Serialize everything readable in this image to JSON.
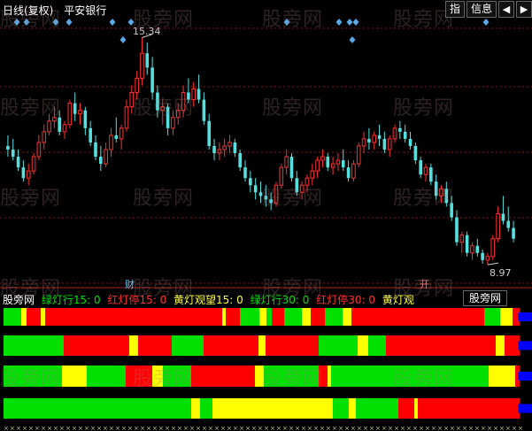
{
  "header": {
    "period": "日线(复权)",
    "stock_name": "平安银行"
  },
  "buttons": {
    "zhi": "指",
    "info": "信息",
    "left": "◀",
    "right": "▶"
  },
  "price": {
    "high": "15.34",
    "low": "8.97"
  },
  "markers": {
    "cai": "财",
    "kai": "开"
  },
  "watermark": "股旁网",
  "indicator": {
    "source": "股旁网",
    "green_line_15": "绿灯行15: 0",
    "red_line_15": "红灯停15: 0",
    "yellow_watch_15": "黄灯观望15: 0",
    "green_line_30": "绿灯行30: 0",
    "red_line_30": "红灯停30: 0",
    "yellow_watch": "黄灯观",
    "right_tab": "股旁网"
  },
  "colors": {
    "up": "#ff3030",
    "down": "#55e0e0",
    "green": "#00e000",
    "red": "#ff0000",
    "yellow": "#ffff00",
    "blue": "#0000ff",
    "diamond": "#5aa8e6",
    "grid": "#8b1010"
  },
  "chart_data": {
    "type": "candlestick",
    "ylim": [
      8.5,
      15.8
    ],
    "candles": [
      [
        12.3,
        12.6,
        12.0,
        12.2
      ],
      [
        12.2,
        12.5,
        11.9,
        12.0
      ],
      [
        12.0,
        12.2,
        11.6,
        11.7
      ],
      [
        11.7,
        11.9,
        11.3,
        11.4
      ],
      [
        11.4,
        11.8,
        11.2,
        11.6
      ],
      [
        11.6,
        12.1,
        11.5,
        12.0
      ],
      [
        12.0,
        12.6,
        11.9,
        12.4
      ],
      [
        12.4,
        12.9,
        12.2,
        12.7
      ],
      [
        12.7,
        13.2,
        12.6,
        13.0
      ],
      [
        13.0,
        13.4,
        12.8,
        13.1
      ],
      [
        13.1,
        13.3,
        12.6,
        12.7
      ],
      [
        12.7,
        13.0,
        12.5,
        12.9
      ],
      [
        12.9,
        13.6,
        12.8,
        13.5
      ],
      [
        13.5,
        13.8,
        13.0,
        13.2
      ],
      [
        13.2,
        13.5,
        12.9,
        13.3
      ],
      [
        13.3,
        13.4,
        12.6,
        12.8
      ],
      [
        12.8,
        13.0,
        12.3,
        12.4
      ],
      [
        12.4,
        12.6,
        11.9,
        12.0
      ],
      [
        12.0,
        12.3,
        11.6,
        11.8
      ],
      [
        11.8,
        12.4,
        11.7,
        12.2
      ],
      [
        12.2,
        12.8,
        12.0,
        12.6
      ],
      [
        12.6,
        13.1,
        12.4,
        12.5
      ],
      [
        12.5,
        12.9,
        12.2,
        12.8
      ],
      [
        12.8,
        13.6,
        12.7,
        13.4
      ],
      [
        13.4,
        14.0,
        13.2,
        13.8
      ],
      [
        13.8,
        14.4,
        13.6,
        14.2
      ],
      [
        14.2,
        15.34,
        14.0,
        14.9
      ],
      [
        14.9,
        15.2,
        14.3,
        14.5
      ],
      [
        14.5,
        14.8,
        13.6,
        13.8
      ],
      [
        13.8,
        14.0,
        13.1,
        13.3
      ],
      [
        13.3,
        13.6,
        12.9,
        13.4
      ],
      [
        13.4,
        13.5,
        12.6,
        12.8
      ],
      [
        12.8,
        13.3,
        12.6,
        13.1
      ],
      [
        13.1,
        13.5,
        12.9,
        13.3
      ],
      [
        13.3,
        14.0,
        13.1,
        13.8
      ],
      [
        13.8,
        14.2,
        13.5,
        13.6
      ],
      [
        13.6,
        14.1,
        13.4,
        13.9
      ],
      [
        13.9,
        14.3,
        13.5,
        13.6
      ],
      [
        13.6,
        13.8,
        12.9,
        13.0
      ],
      [
        13.0,
        13.2,
        12.2,
        12.3
      ],
      [
        12.3,
        12.5,
        11.9,
        12.1
      ],
      [
        12.1,
        12.4,
        11.9,
        12.2
      ],
      [
        12.2,
        12.5,
        12.0,
        12.3
      ],
      [
        12.3,
        12.6,
        12.1,
        12.4
      ],
      [
        12.4,
        12.5,
        12.0,
        12.1
      ],
      [
        12.1,
        12.2,
        11.6,
        11.7
      ],
      [
        11.7,
        11.9,
        11.3,
        11.4
      ],
      [
        11.4,
        11.6,
        11.0,
        11.2
      ],
      [
        11.2,
        11.4,
        10.8,
        11.0
      ],
      [
        11.0,
        11.3,
        10.7,
        10.9
      ],
      [
        10.9,
        11.2,
        10.6,
        10.8
      ],
      [
        10.8,
        11.0,
        10.5,
        10.7
      ],
      [
        10.7,
        11.3,
        10.6,
        11.2
      ],
      [
        11.2,
        11.8,
        11.1,
        11.7
      ],
      [
        11.7,
        12.2,
        11.5,
        12.0
      ],
      [
        12.0,
        12.1,
        11.3,
        11.4
      ],
      [
        11.4,
        11.6,
        10.9,
        11.0
      ],
      [
        11.0,
        11.3,
        10.8,
        11.2
      ],
      [
        11.2,
        11.5,
        11.0,
        11.4
      ],
      [
        11.4,
        11.8,
        11.2,
        11.6
      ],
      [
        11.6,
        12.0,
        11.4,
        11.9
      ],
      [
        11.9,
        12.2,
        11.7,
        12.0
      ],
      [
        12.0,
        12.1,
        11.6,
        11.7
      ],
      [
        11.7,
        12.0,
        11.5,
        11.8
      ],
      [
        11.8,
        12.1,
        11.6,
        11.9
      ],
      [
        11.9,
        12.2,
        11.6,
        11.7
      ],
      [
        11.7,
        11.9,
        11.3,
        11.4
      ],
      [
        11.4,
        11.9,
        11.3,
        11.8
      ],
      [
        11.8,
        12.4,
        11.7,
        12.3
      ],
      [
        12.3,
        12.7,
        12.1,
        12.5
      ],
      [
        12.5,
        12.8,
        12.2,
        12.4
      ],
      [
        12.4,
        12.7,
        12.2,
        12.6
      ],
      [
        12.6,
        12.9,
        12.3,
        12.5
      ],
      [
        12.5,
        12.7,
        12.1,
        12.2
      ],
      [
        12.2,
        12.6,
        12.0,
        12.5
      ],
      [
        12.5,
        12.9,
        12.4,
        12.8
      ],
      [
        12.8,
        13.0,
        12.5,
        12.7
      ],
      [
        12.7,
        12.9,
        12.4,
        12.5
      ],
      [
        12.5,
        12.7,
        12.2,
        12.3
      ],
      [
        12.3,
        12.4,
        11.8,
        11.9
      ],
      [
        11.9,
        12.0,
        11.4,
        11.5
      ],
      [
        11.5,
        11.8,
        11.3,
        11.7
      ],
      [
        11.7,
        11.8,
        11.2,
        11.3
      ],
      [
        11.3,
        11.5,
        10.8,
        10.9
      ],
      [
        10.9,
        11.2,
        10.7,
        11.1
      ],
      [
        11.1,
        11.3,
        10.6,
        10.7
      ],
      [
        10.7,
        10.9,
        10.2,
        10.3
      ],
      [
        10.3,
        10.5,
        9.5,
        9.6
      ],
      [
        9.6,
        9.9,
        9.3,
        9.8
      ],
      [
        9.8,
        9.9,
        9.2,
        9.3
      ],
      [
        9.3,
        9.6,
        9.1,
        9.5
      ],
      [
        9.5,
        9.7,
        9.2,
        9.3
      ],
      [
        9.3,
        9.4,
        9.0,
        9.1
      ],
      [
        9.1,
        9.3,
        8.97,
        9.2
      ],
      [
        9.2,
        9.8,
        9.1,
        9.7
      ],
      [
        9.7,
        10.6,
        9.6,
        10.4
      ],
      [
        10.4,
        10.9,
        10.1,
        10.2
      ],
      [
        10.2,
        10.6,
        9.9,
        10.0
      ],
      [
        10.0,
        10.2,
        9.6,
        9.7
      ]
    ]
  }
}
